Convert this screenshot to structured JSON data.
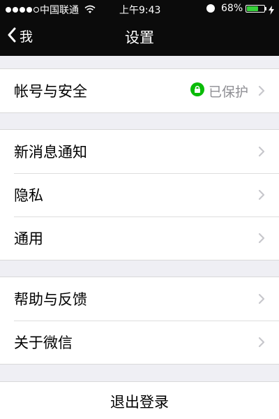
{
  "status_bar": {
    "carrier": "中国联通",
    "time": "上午9:43",
    "battery_percent_text": "68%",
    "battery_level": 0.68,
    "signal_strength": 4,
    "signal_max": 5,
    "battery_color": "#36d13a"
  },
  "nav": {
    "back_label": "我",
    "title": "设置"
  },
  "groups": [
    {
      "items": [
        {
          "label": "帐号与安全",
          "status": "已保护",
          "status_icon": "lock-icon",
          "status_icon_color": "#09bb07"
        }
      ]
    },
    {
      "items": [
        {
          "label": "新消息通知"
        },
        {
          "label": "隐私"
        },
        {
          "label": "通用"
        }
      ]
    },
    {
      "items": [
        {
          "label": "帮助与反馈"
        },
        {
          "label": "关于微信"
        }
      ]
    }
  ],
  "logout": {
    "label": "退出登录"
  }
}
